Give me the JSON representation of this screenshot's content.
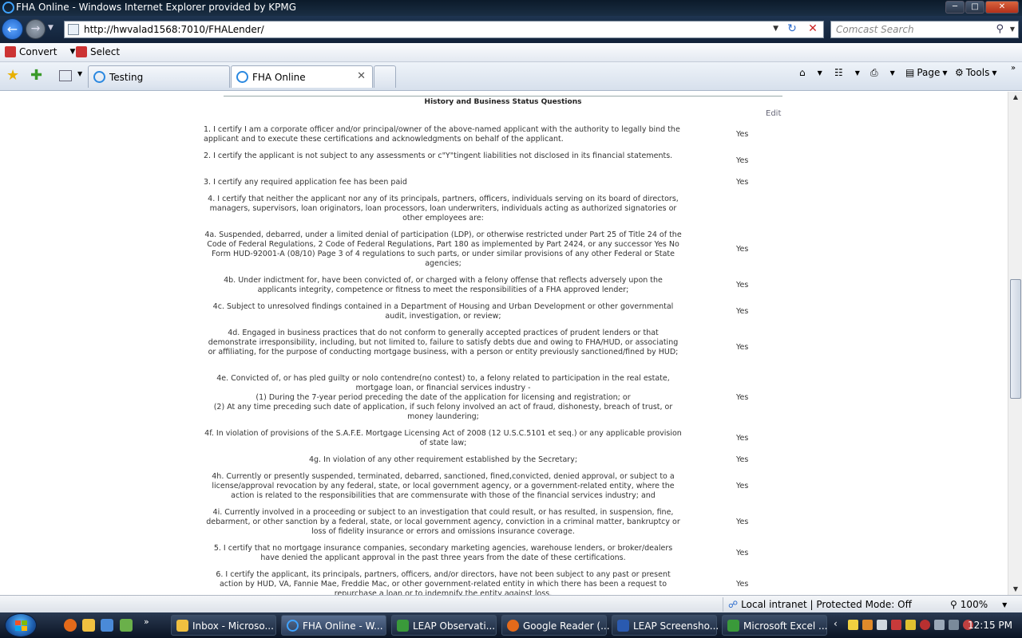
{
  "window": {
    "title": "FHA Online - Windows Internet Explorer provided by KPMG"
  },
  "nav": {
    "url": "http://hwvalad1568:7010/FHALender/",
    "search_placeholder": "Comcast Search"
  },
  "commandbar": {
    "convert_label": "Convert",
    "select_label": "Select"
  },
  "tabs": [
    {
      "label": "Testing"
    },
    {
      "label": "FHA Online"
    }
  ],
  "toolbar": {
    "page_label": "Page",
    "tools_label": "Tools"
  },
  "section": {
    "title": "History and Business Status Questions",
    "edit_label": "Edit"
  },
  "questions": [
    {
      "text": "1. I certify I am a corporate officer and/or principal/owner of the above-named applicant with the authority to legally bind the applicant and to execute these certifications and acknowledgments on behalf of the applicant.",
      "answer": "Yes"
    },
    {
      "text": "2. I certify the applicant is not subject to any assessments or c\"Y\"tingent liabilities not disclosed in its financial statements.",
      "answer": "Yes"
    },
    {
      "text": "3. I certify any required application fee has been paid",
      "answer": "Yes"
    },
    {
      "text": "4. I certify that neither the applicant nor any of its principals, partners, officers, individuals serving on its board of directors, managers, supervisors, loan originators, loan processors, loan underwriters, individuals acting as authorized signatories or other employees are:",
      "answer": ""
    },
    {
      "text": "4a. Suspended, debarred, under a limited denial of participation (LDP), or otherwise restricted under Part 25 of Title 24 of the Code of Federal Regulations, 2 Code of Federal Regulations, Part 180 as implemented by Part 2424, or any successor Yes No Form HUD-92001-A (08/10) Page 3 of 4 regulations to such parts, or under similar provisions of any other Federal or State agencies;",
      "answer": "Yes"
    },
    {
      "text": "4b. Under indictment for, have been convicted of, or charged with a felony offense that reflects adversely upon the applicants integrity, competence or fitness to meet the responsibilities of a FHA approved lender;",
      "answer": "Yes"
    },
    {
      "text": "4c. Subject to unresolved findings contained in a Department of Housing and Urban Development or other governmental audit, investigation, or review;",
      "answer": "Yes"
    },
    {
      "text": "4d. Engaged in business practices that do not conform to generally accepted practices of prudent lenders or that demonstrate irresponsibility, including, but not limited to, failure to satisfy debts due and owing to FHA/HUD, or associating or affiliating, for the purpose of conducting mortgage business, with a person or entity previously sanctioned/fined by HUD;",
      "answer": "Yes"
    },
    {
      "text": "4e. Convicted of, or has pled guilty or nolo contendre(no contest) to, a felony related to participation in the real estate, mortgage loan, or financial services industry -",
      "sub1": "(1) During the 7-year period preceding the date of the application for licensing and registration; or",
      "sub2": "(2) At any time preceding such date of application, if such felony involved an act of fraud, dishonesty, breach of trust, or money laundering;",
      "answer": "Yes"
    },
    {
      "text": "4f. In violation of provisions of the S.A.F.E. Mortgage Licensing Act of 2008 (12 U.S.C.5101 et seq.) or any applicable provision of state law;",
      "answer": "Yes"
    },
    {
      "text": "4g. In violation of any other requirement established by the Secretary;",
      "answer": "Yes"
    },
    {
      "text": "4h. Currently or presently suspended, terminated, debarred, sanctioned, fined,convicted, denied approval, or subject to a license/approval revocation by any federal, state, or local government agency, or a government-related entity, where the action is related to the responsibilities that are commensurate with those of the financial services industry; and",
      "answer": "Yes"
    },
    {
      "text": "4i. Currently involved in a proceeding or subject to an investigation that could result, or has resulted, in suspension, fine, debarment, or other sanction by a federal, state, or local government agency, conviction in a criminal matter, bankruptcy or loss of fidelity insurance or errors and omissions insurance coverage.",
      "answer": "Yes"
    },
    {
      "text": "5. I certify that no mortgage insurance companies, secondary marketing agencies, warehouse lenders, or broker/dealers have denied the applicant approval in the past three years from the date of these certifications.",
      "answer": "Yes"
    },
    {
      "text": "6. I certify the applicant, its principals, partners, officers, and/or directors, have not been subject to any past or present action by HUD, VA, Fannie Mae, Freddie Mac, or other government-related entity in which there has been a request to repurchase a loan or to indemnify the entity against loss.",
      "answer": "Yes"
    }
  ],
  "status": {
    "zone": "Local intranet | Protected Mode: Off",
    "zoom": "100%"
  },
  "taskbar": {
    "buttons": [
      {
        "label": "Inbox - Microso..."
      },
      {
        "label": "FHA Online - W..."
      },
      {
        "label": "LEAP Observati..."
      },
      {
        "label": "Google Reader (..."
      },
      {
        "label": "LEAP Screensho..."
      },
      {
        "label": "Microsoft Excel ..."
      }
    ],
    "clock": "12:15 PM"
  }
}
